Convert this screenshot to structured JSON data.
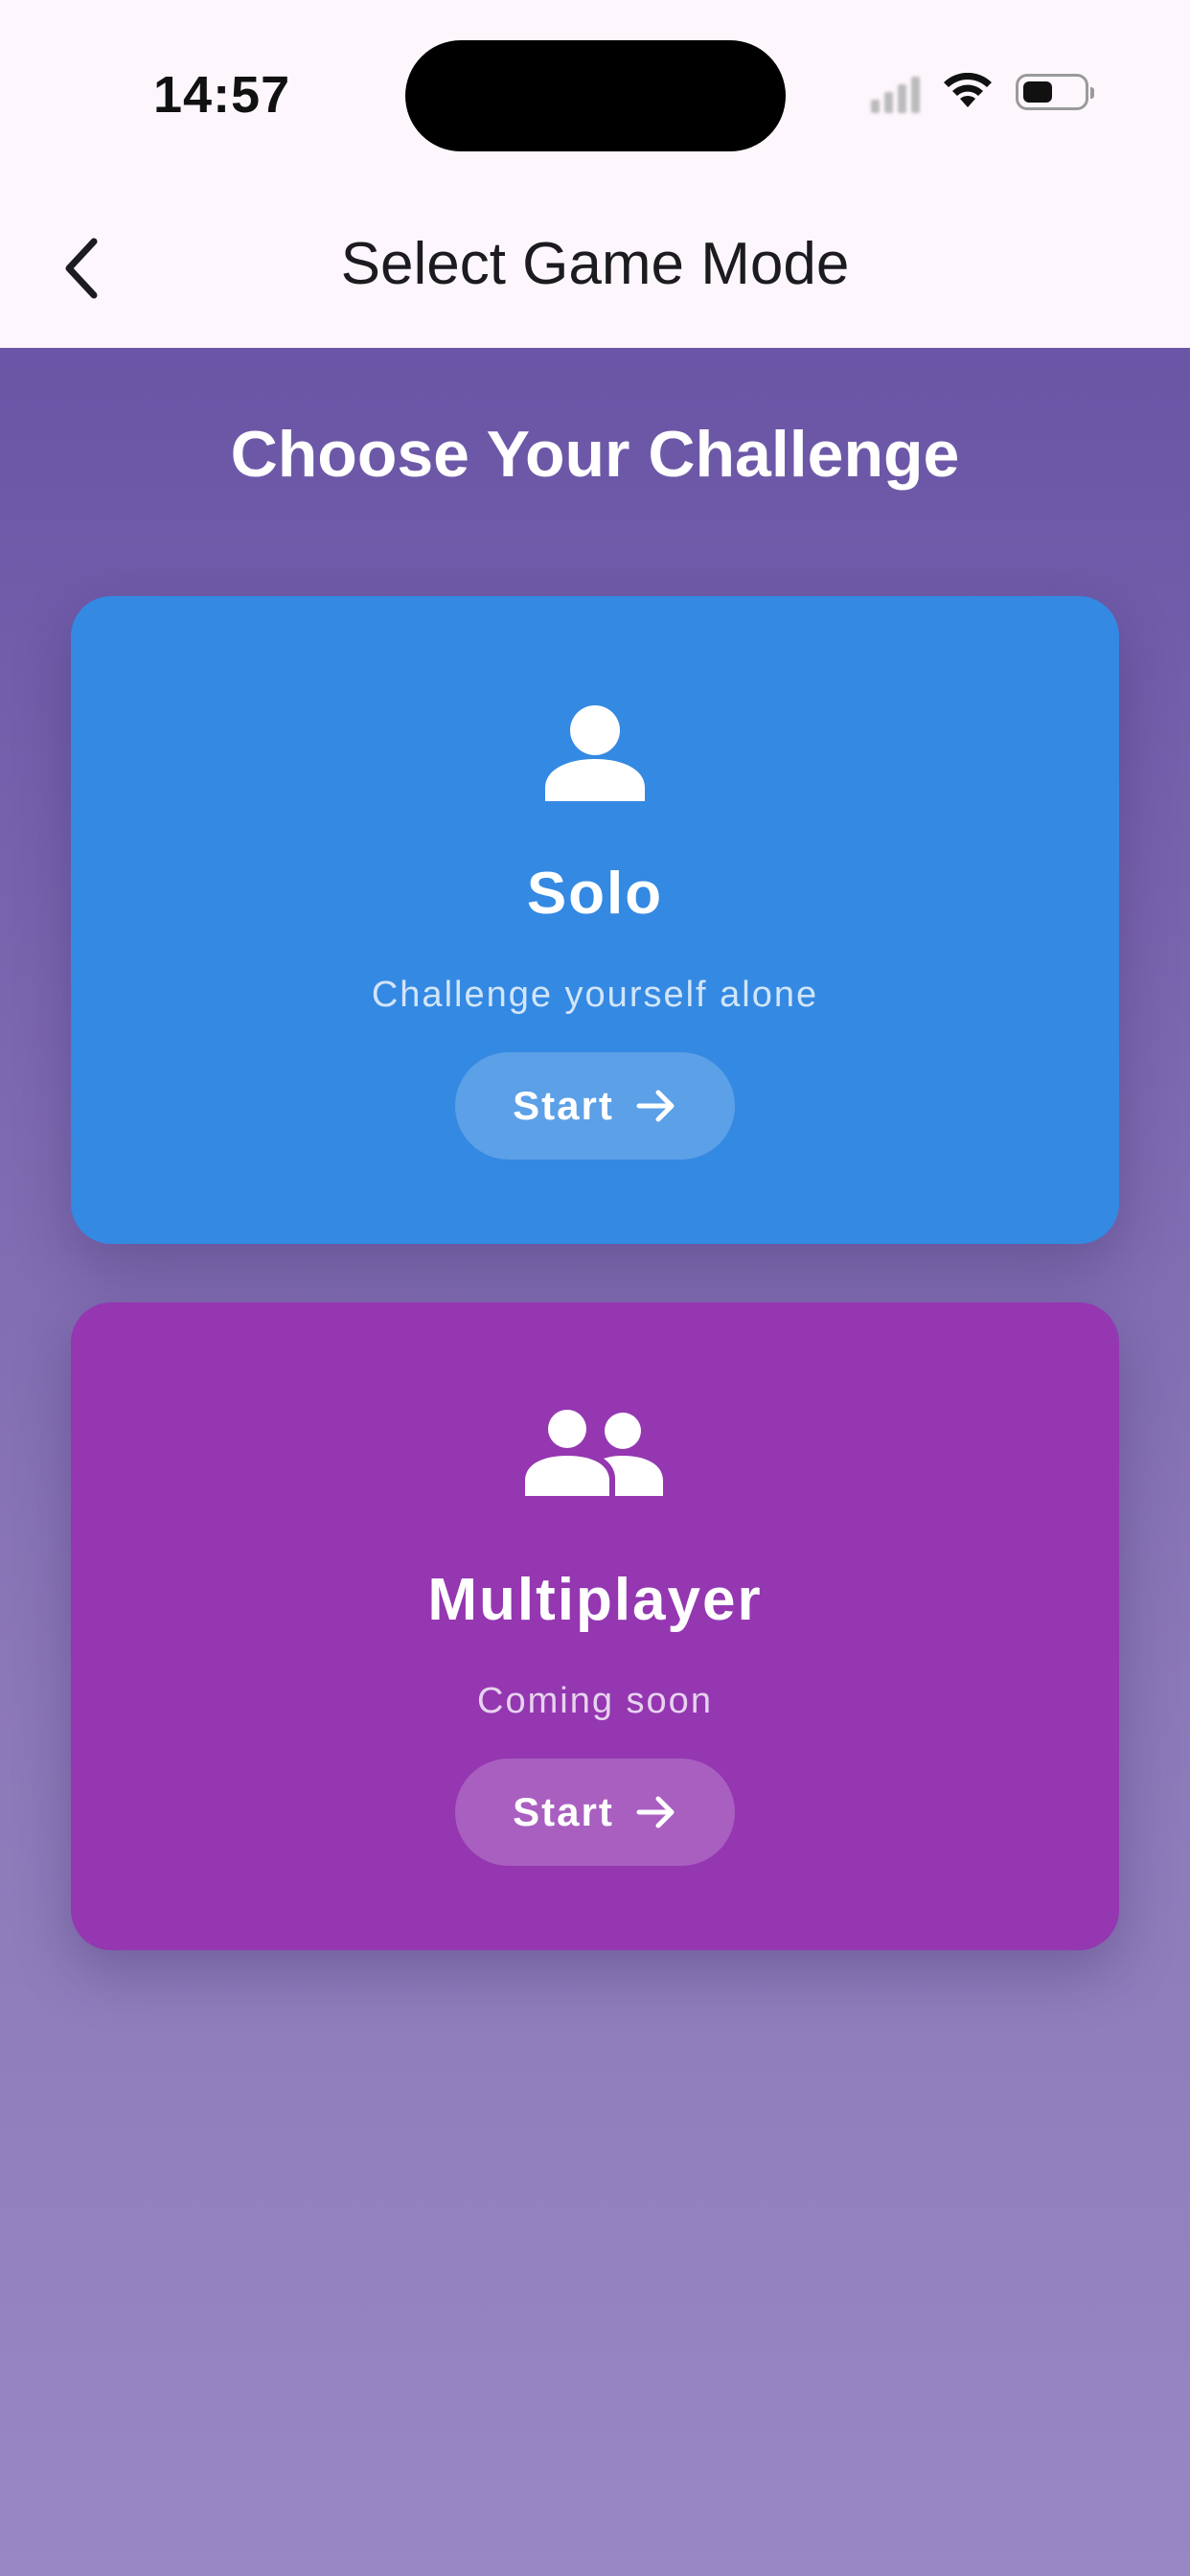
{
  "status_bar": {
    "time": "14:57"
  },
  "nav": {
    "title": "Select Game Mode",
    "back_icon": "chevron-left-icon"
  },
  "heading": "Choose Your Challenge",
  "modes": [
    {
      "title": "Solo",
      "subtitle": "Challenge yourself alone",
      "button_label": "Start",
      "icon": "person-icon",
      "color": "#3489e2"
    },
    {
      "title": "Multiplayer",
      "subtitle": "Coming soon",
      "button_label": "Start",
      "icon": "people-icon",
      "color": "#9437b1"
    }
  ],
  "colors": {
    "background_top": "#6a55a6",
    "background_bottom": "#9887c2",
    "appbar": "#fdf7fd"
  }
}
